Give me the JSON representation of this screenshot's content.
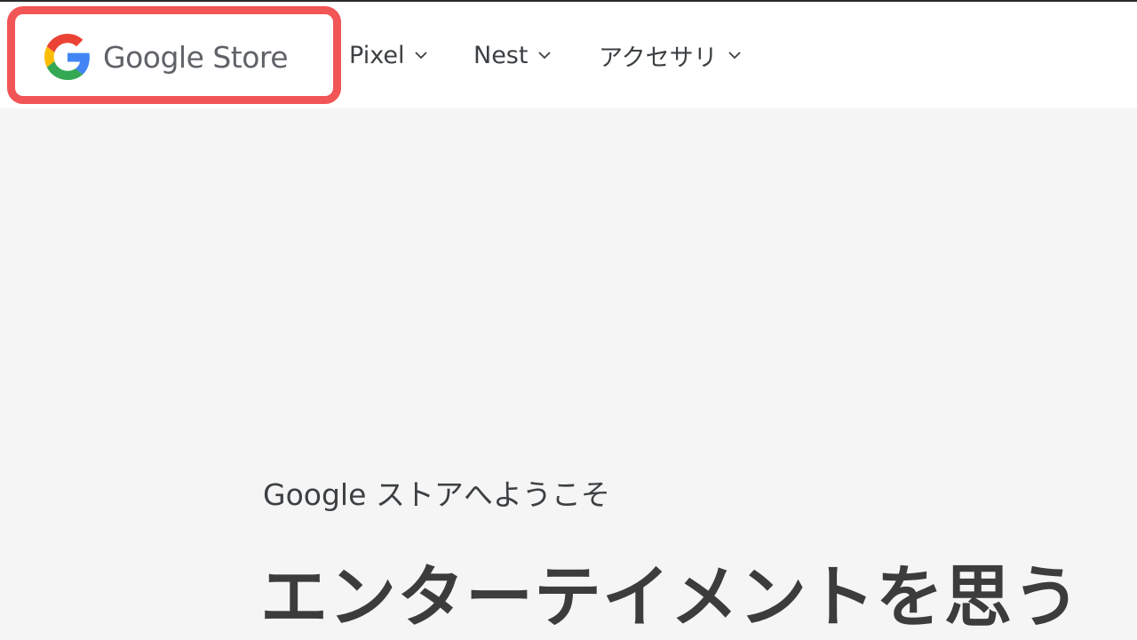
{
  "header": {
    "logo_text": "Google Store",
    "nav": [
      {
        "label": "Pixel"
      },
      {
        "label": "Nest"
      },
      {
        "label": "アクセサリ"
      }
    ]
  },
  "hero": {
    "welcome": "Google ストアへようこそ",
    "headline": "エンターテイメントを思う"
  },
  "colors": {
    "highlight": "#f25555",
    "logo_text": "#5f6368",
    "page_background": "#f5f5f5"
  },
  "icons": {
    "logo": "google-g-icon",
    "nav_dropdown": "chevron-down-icon"
  }
}
